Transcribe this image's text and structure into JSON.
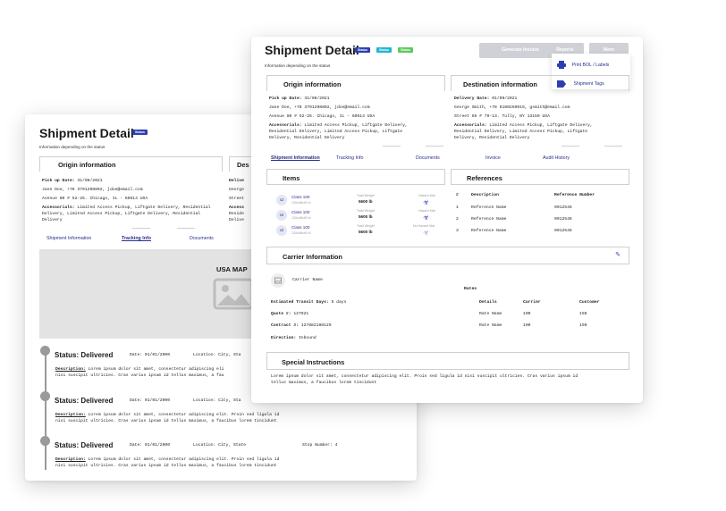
{
  "back": {
    "title": "Shipment Detail",
    "status_badge": "Status",
    "subtitle": "Information depending on the status",
    "origin": {
      "heading": "Origin information",
      "pickup_label": "Pick up Date:",
      "pickup_date": "31/08/2021",
      "contact": "Jane Doe, +78 3791298892, jdoe@email.com",
      "address": "Avenue 80 # 52-25. Chicago, IL - 60614 USA",
      "accessorials_label": "Accessorials:",
      "accessorials": "Limited Access Pickup, Liftgate Delivery, Residential Delivery, Limited Access Pickup, Liftgate Delivery, Residential Delivery"
    },
    "dest_partial": {
      "heading": "Des",
      "line1": "Delive",
      "line2": "George",
      "line3": "Street",
      "line4": "Access",
      "line5": "Reside",
      "line6": "Delive"
    },
    "tabs": [
      "Shipment Information",
      "Tracking Info",
      "Documents"
    ],
    "map_label": "USA MAP",
    "timeline": [
      {
        "status": "Status: Delivered",
        "date": "Date: 01/01/2000",
        "location": "Location: City, Sta",
        "stop": "",
        "desc_label": "Description:",
        "desc1": "Lorem ipsum dolor sit amet, consectetur adipiscing eli",
        "desc2": "nisi suscipit ultricies. Cras varius ipsum id tellus maximus, a fau"
      },
      {
        "status": "Status: Delivered",
        "date": "Date: 01/01/2000",
        "location": "Location: City, Sta",
        "stop": "",
        "desc_label": "Description:",
        "desc1": "Lorem ipsum dolor sit amet, consectetur adipiscing elit. Proin sed ligula id",
        "desc2": "nisi suscipit ultricies. Cras varius ipsum id tellus maximus, a faucibus lorem tincidunt"
      },
      {
        "status": "Status: Delivered",
        "date": "Date: 01/01/2000",
        "location": "Location: City, State",
        "stop": "Stop Number: 4",
        "desc_label": "Description:",
        "desc1": "Lorem ipsum dolor sit amet, consectetur adipiscing elit. Proin sed ligula id",
        "desc2": "nisi suscipit ultricies. Cras varius ipsum id tellus maximus, a faucibus lorem tincidunt"
      }
    ]
  },
  "front": {
    "title": "Shipment Detail",
    "badges": [
      {
        "label": "Status",
        "color": "#2d3fb0"
      },
      {
        "label": "Status",
        "color": "#1fb6d0"
      },
      {
        "label": "Status",
        "color": "#5cc95c"
      }
    ],
    "subtitle": "Information depending on the status",
    "buttons": {
      "generate": "Generate Invoice",
      "reports": "Reports",
      "more": "More"
    },
    "menu": {
      "print": "Print BOL / Labels",
      "tags": "Shipment Tags"
    },
    "origin": {
      "heading": "Origin information",
      "pickup_label": "Pick up Date:",
      "pickup_date": "31/08/2021",
      "contact": "Jane Doe, +78 3791298892, jdoe@email.com",
      "address": "Avenue 80 # 52-25. Chicago, IL - 60614 USA",
      "accessorials_label": "Accessorials:",
      "acc1": "Limited Access Pickup, Liftgate Delivery,",
      "acc2": "Residential Delivery, Limited Access Pickup, Liftgate",
      "acc3": "Delivery, Residential Delivery"
    },
    "destination": {
      "heading": "Destination information",
      "delivery_label": "Delivery Date:",
      "delivery_date": "01/09/2021",
      "contact": "George Smith, +78 6180259015, gsmith@email.com",
      "address": "Street 65 # 79-13. Tully, NY 13159 USA",
      "accessorials_label": "Accessorials:",
      "acc1": "Limited Access Pickup, Liftgate Delivery,",
      "acc2": "Residential Delivery, Limited Access Pickup, Liftgate",
      "acc3": "Delivery, Residential Delivery"
    },
    "tabs": [
      "Shipment Information",
      "Tracking Info",
      "Documents",
      "Invoice",
      "Audit History"
    ],
    "items": {
      "heading": "Items",
      "rows": [
        {
          "qty": "x2",
          "cls": "Class 100",
          "dims": "120x48x40 In",
          "tw_label": "Total Weight",
          "tw": "5600 lb",
          "haz_label": "Hazard Mat"
        },
        {
          "qty": "x2",
          "cls": "Class 100",
          "dims": "120x48x40 In",
          "tw_label": "Total Weight",
          "tw": "5600 lb",
          "haz_label": "Hazard Mat"
        },
        {
          "qty": "x2",
          "cls": "Class 100",
          "dims": "120x48x40 In",
          "tw_label": "Total Weight",
          "tw": "5600 lb",
          "haz_label": "No Hazard Mat"
        }
      ]
    },
    "references": {
      "heading": "References",
      "col_num": "#",
      "col_desc": "Description",
      "col_ref": "Reference Number",
      "rows": [
        {
          "n": "1",
          "d": "Reference Name",
          "r": "0012546"
        },
        {
          "n": "2",
          "d": "Reference Name",
          "r": "0012546"
        },
        {
          "n": "3",
          "d": "Reference Name",
          "r": "0012546"
        }
      ]
    },
    "carrier": {
      "heading": "Carrier Information",
      "name": "Carrier Name",
      "transit_label": "Estimated Transit Days:",
      "transit": "5 days",
      "quote_label": "Quote #:",
      "quote": "127921",
      "contract_label": "Contract #:",
      "contract": "127882188129",
      "direction_label": "Direction:",
      "direction": "Inbound",
      "rates_heading": "Rates",
      "rates_cols": [
        "Details",
        "Carrier",
        "Customer"
      ],
      "rates_rows": [
        [
          "Rate Name",
          "100",
          "150"
        ],
        [
          "Rate Name",
          "100",
          "150"
        ]
      ]
    },
    "special": {
      "heading": "Special Instructions",
      "line1": "Lorem ipsum dolor sit amet, consectetur adipiscing elit. Proin sed ligula id nisi suscipit ultricies. Cras varius ipsum id",
      "line2": "tellus maximus, a faucibus lorem tincidunt"
    }
  }
}
